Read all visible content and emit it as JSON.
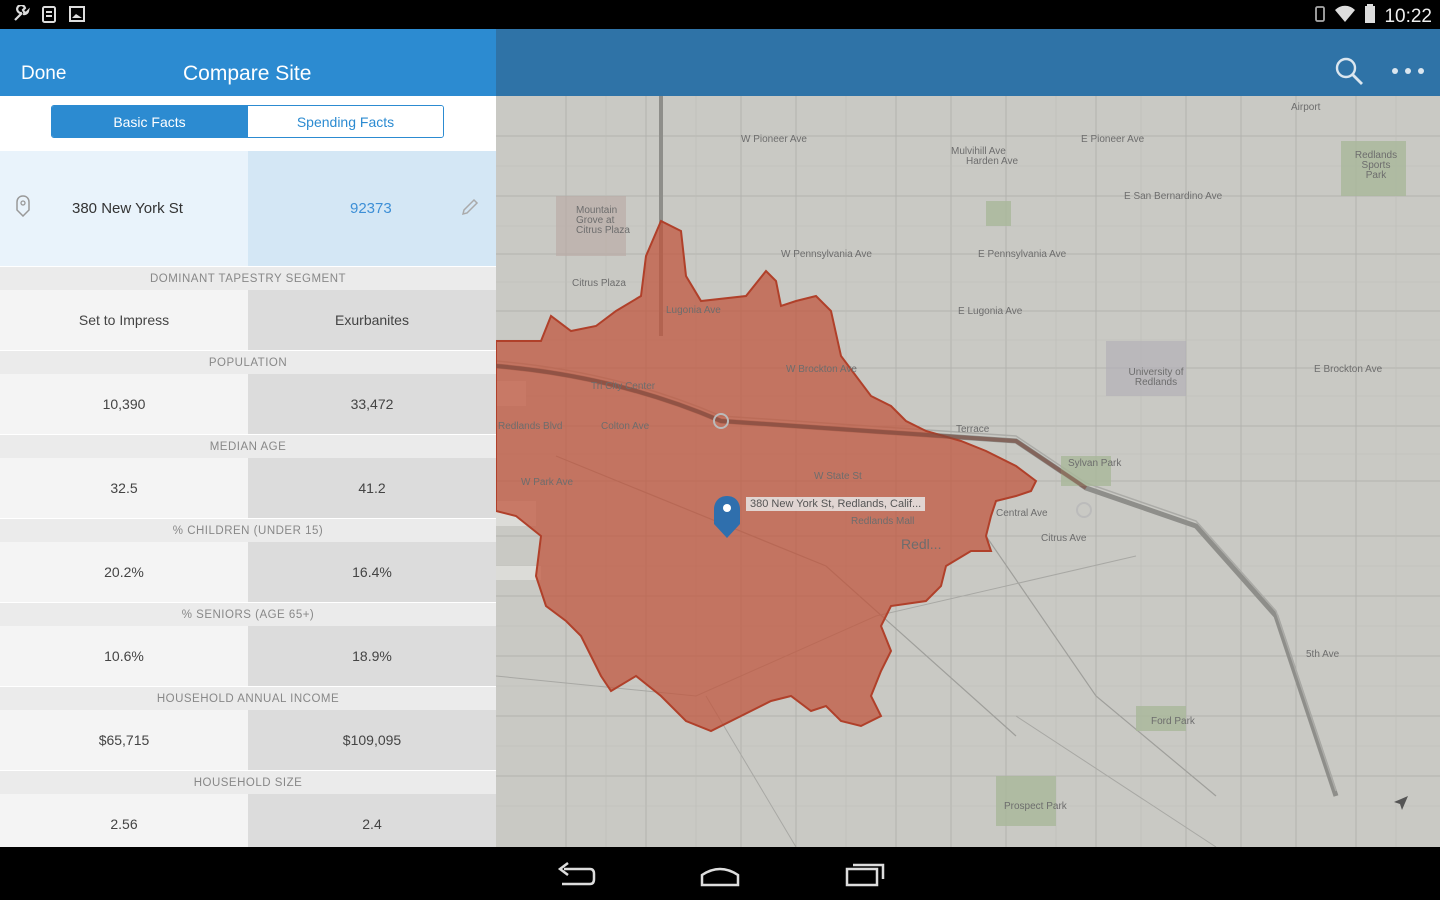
{
  "status_bar": {
    "time": "10:22",
    "left_icons": [
      "wrench-icon",
      "clipboard-icon",
      "image-icon"
    ],
    "right_icons": [
      "vibrate-icon",
      "wifi-icon",
      "battery-icon"
    ]
  },
  "left_panel": {
    "done_label": "Done",
    "title": "Compare Site",
    "tabs": [
      {
        "label": "Basic Facts",
        "active": true
      },
      {
        "label": "Spending Facts",
        "active": false
      }
    ],
    "site": {
      "name": "380 New York St",
      "zip": "92373"
    },
    "sections": [
      {
        "label": "DOMINANT TAPESTRY SEGMENT",
        "a": "Set to Impress",
        "b": "Exurbanites"
      },
      {
        "label": "POPULATION",
        "a": "10,390",
        "b": "33,472"
      },
      {
        "label": "MEDIAN AGE",
        "a": "32.5",
        "b": "41.2"
      },
      {
        "label": "% CHILDREN (UNDER 15)",
        "a": "20.2%",
        "b": "16.4%"
      },
      {
        "label": "% SENIORS (AGE 65+)",
        "a": "10.6%",
        "b": "18.9%"
      },
      {
        "label": "HOUSEHOLD ANNUAL INCOME",
        "a": "$65,715",
        "b": "$109,095"
      },
      {
        "label": "HOUSEHOLD SIZE",
        "a": "2.56",
        "b": "2.4"
      }
    ]
  },
  "map": {
    "pin_label": "380 New York St, Redlands, Calif...",
    "labels": [
      "W Pioneer Ave",
      "E Pioneer Ave",
      "Mulvihill Ave",
      "Harden Ave",
      "E San Bernardino Ave",
      "Mountain Grove at Citrus Plaza",
      "Citrus Plaza",
      "W Pennsylvania Ave",
      "E Pennsylvania Ave",
      "Lugonia Ave",
      "E Lugonia Ave",
      "W Brockton Ave",
      "E Brockton Ave",
      "University of Redlands",
      "Tri City Center",
      "Redlands Blvd",
      "Colton Ave",
      "Terrace",
      "W Park Ave",
      "W State St",
      "Sylvan Park",
      "Central Ave",
      "Redlands Mall",
      "Redl...",
      "Citrus Ave",
      "5th Ave",
      "Ford Park",
      "Prospect Park",
      "Redlands Sports Park",
      "Airport"
    ],
    "colors": {
      "trade_area": "#c0533a",
      "pin": "#2f6fad"
    }
  },
  "nav_bar": {
    "buttons": [
      "back-icon",
      "home-icon",
      "recent-apps-icon"
    ]
  }
}
